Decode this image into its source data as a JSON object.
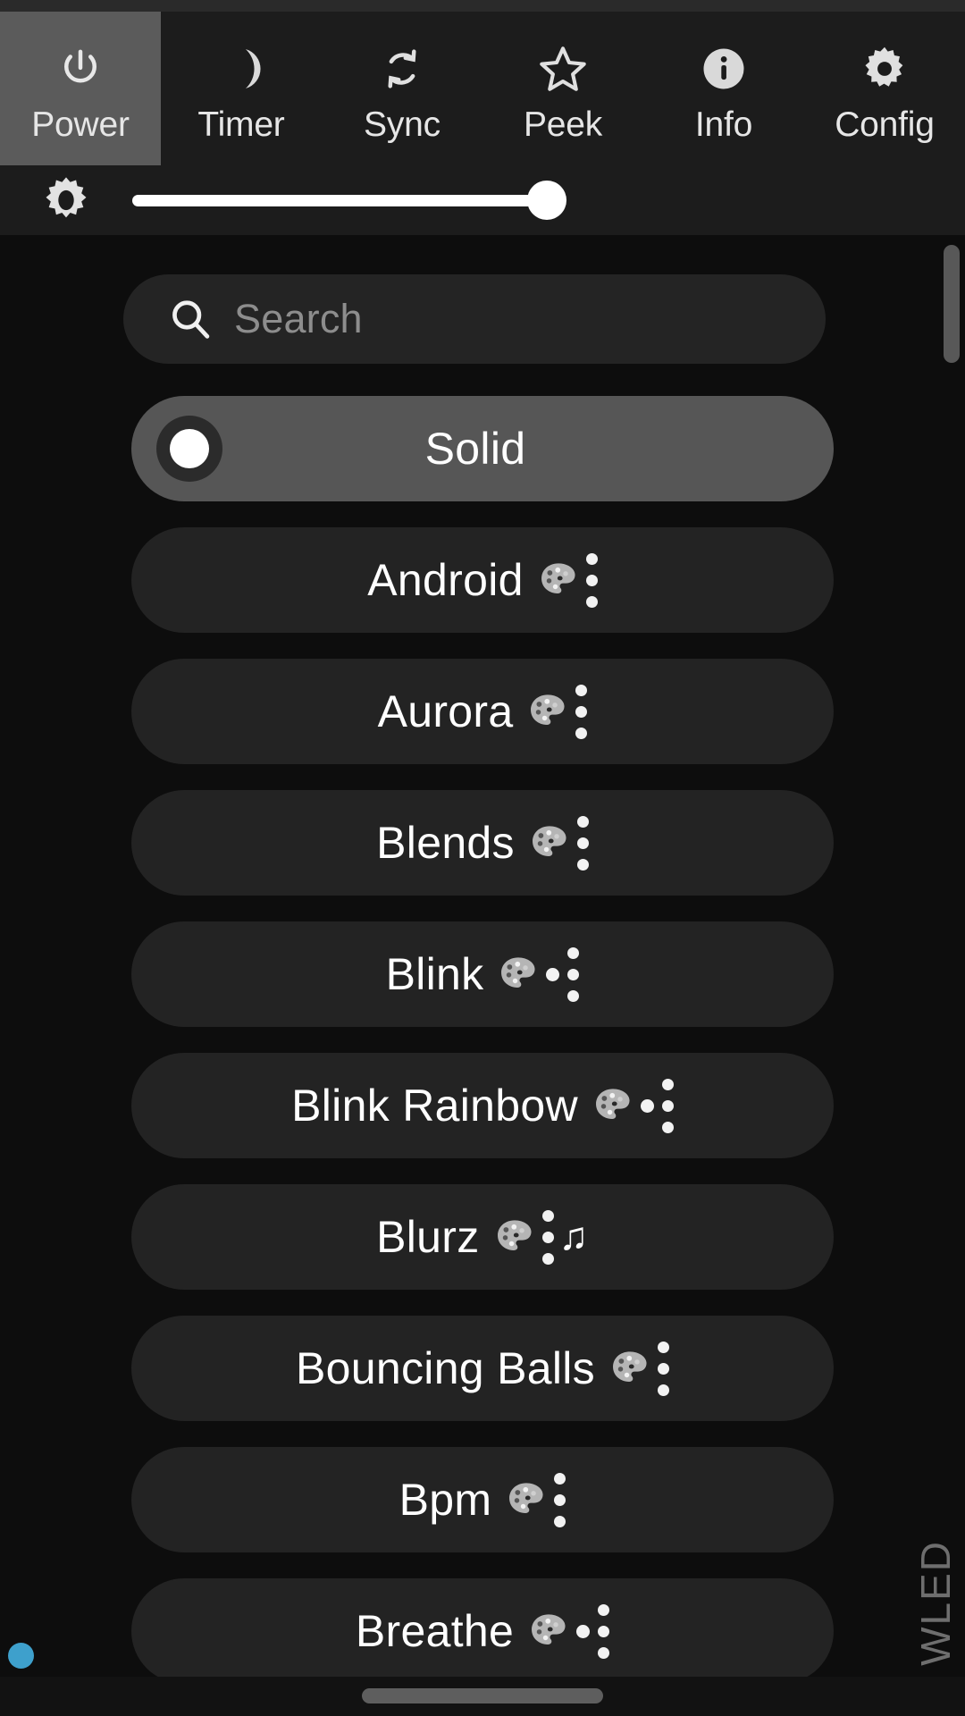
{
  "app": {
    "brand": "WLED",
    "accent_blue": "#3ea0cc",
    "background": "#0d0d0d",
    "toolbar_background": "#1c1c1c",
    "active_tab_background": "#5b5b5b"
  },
  "toolbar": {
    "tabs": [
      {
        "label": "Power",
        "icon": "power-icon",
        "active": true
      },
      {
        "label": "Timer",
        "icon": "moon-icon",
        "active": false
      },
      {
        "label": "Sync",
        "icon": "sync-icon",
        "active": false
      },
      {
        "label": "Peek",
        "icon": "star-icon",
        "active": false
      },
      {
        "label": "Info",
        "icon": "info-icon",
        "active": false
      },
      {
        "label": "Config",
        "icon": "gear-icon",
        "active": false
      }
    ]
  },
  "brightness": {
    "icon": "brightness-sun-icon",
    "value_percent": 100,
    "track_color": "#ffffff"
  },
  "search": {
    "icon": "search-icon",
    "placeholder": "Search",
    "value": ""
  },
  "effects": {
    "selected": "Solid",
    "items": [
      {
        "name": "Solid",
        "selected": true,
        "palette": false,
        "color_dot": false,
        "options": false,
        "audio": false
      },
      {
        "name": "Android",
        "selected": false,
        "palette": true,
        "color_dot": false,
        "options": true,
        "audio": false
      },
      {
        "name": "Aurora",
        "selected": false,
        "palette": true,
        "color_dot": false,
        "options": true,
        "audio": false
      },
      {
        "name": "Blends",
        "selected": false,
        "palette": true,
        "color_dot": false,
        "options": true,
        "audio": false
      },
      {
        "name": "Blink",
        "selected": false,
        "palette": true,
        "color_dot": true,
        "options": true,
        "audio": false
      },
      {
        "name": "Blink Rainbow",
        "selected": false,
        "palette": true,
        "color_dot": true,
        "options": true,
        "audio": false
      },
      {
        "name": "Blurz",
        "selected": false,
        "palette": true,
        "color_dot": false,
        "options": true,
        "audio": true
      },
      {
        "name": "Bouncing Balls",
        "selected": false,
        "palette": true,
        "color_dot": false,
        "options": true,
        "audio": false
      },
      {
        "name": "Bpm",
        "selected": false,
        "palette": true,
        "color_dot": false,
        "options": true,
        "audio": false
      },
      {
        "name": "Breathe",
        "selected": false,
        "palette": true,
        "color_dot": true,
        "options": true,
        "audio": false
      }
    ],
    "glyphs": {
      "audio_note": "♫"
    }
  },
  "status": {
    "connection_indicator": "connected",
    "connection_color": "#3ea0cc"
  },
  "system_nav": {
    "gesture_bar": true
  }
}
